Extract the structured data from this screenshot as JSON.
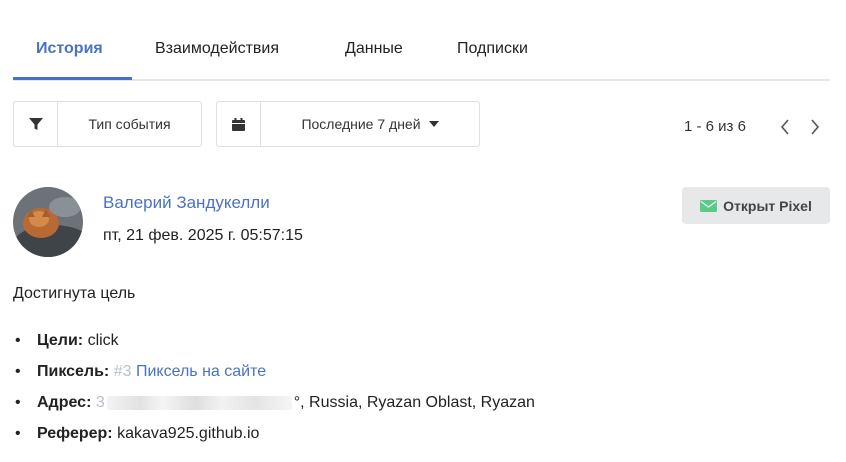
{
  "tabs": [
    {
      "label": "История",
      "active": true
    },
    {
      "label": "Взаимодействия",
      "active": false
    },
    {
      "label": "Данные",
      "active": false
    },
    {
      "label": "Подписки",
      "active": false
    }
  ],
  "filters": {
    "event_type": {
      "label": "Тип события",
      "icon": "funnel-icon"
    },
    "period": {
      "label": "Последние 7 дней",
      "icon": "calendar-icon"
    }
  },
  "pagination": {
    "range": "1 - 6 из 6",
    "prev_icon": "chevron-left-icon",
    "next_icon": "chevron-right-icon"
  },
  "event": {
    "author": "Валерий Зандукелли",
    "timestamp": "пт, 21 фев. 2025 г. 05:57:15",
    "badge": {
      "label": "Открыт Pixel",
      "icon": "envelope-icon",
      "icon_color": "#5cc98a"
    },
    "summary": "Достигнута цель",
    "details": {
      "goals": {
        "label": "Цели:",
        "value": "click"
      },
      "pixel": {
        "label": "Пиксель:",
        "number": "#3",
        "name": "Пиксель на сайте"
      },
      "address": {
        "label": "Адрес:",
        "prefix": "3",
        "suffix": "°, Russia, Ryazan Oblast, Ryazan"
      },
      "referrer": {
        "label": "Реферер:",
        "value": "kakava925.github.io"
      }
    }
  },
  "colors": {
    "accent": "#4a72c4",
    "muted": "#b9c0cc",
    "badge_bg": "#e6e8ea"
  }
}
